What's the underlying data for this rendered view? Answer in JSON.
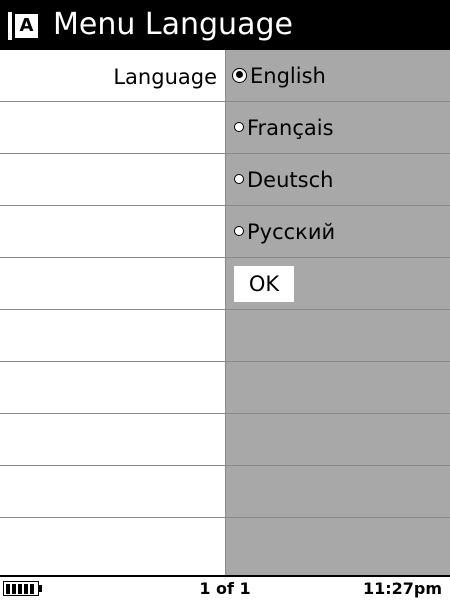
{
  "header": {
    "icon_letter": "A",
    "title": "Menu Language"
  },
  "settings": {
    "label": "Language",
    "options": [
      {
        "label": "English",
        "selected": true
      },
      {
        "label": "Français",
        "selected": false
      },
      {
        "label": "Deutsch",
        "selected": false
      },
      {
        "label": "Русский",
        "selected": false
      }
    ],
    "ok_label": "OK"
  },
  "status": {
    "battery_level": 1.0,
    "page_indicator": "1 of 1",
    "time": "11:27pm"
  },
  "colors": {
    "titlebar_bg": "#000000",
    "value_column_bg": "#a8a8a8",
    "row_divider": "#8a8a8a"
  }
}
